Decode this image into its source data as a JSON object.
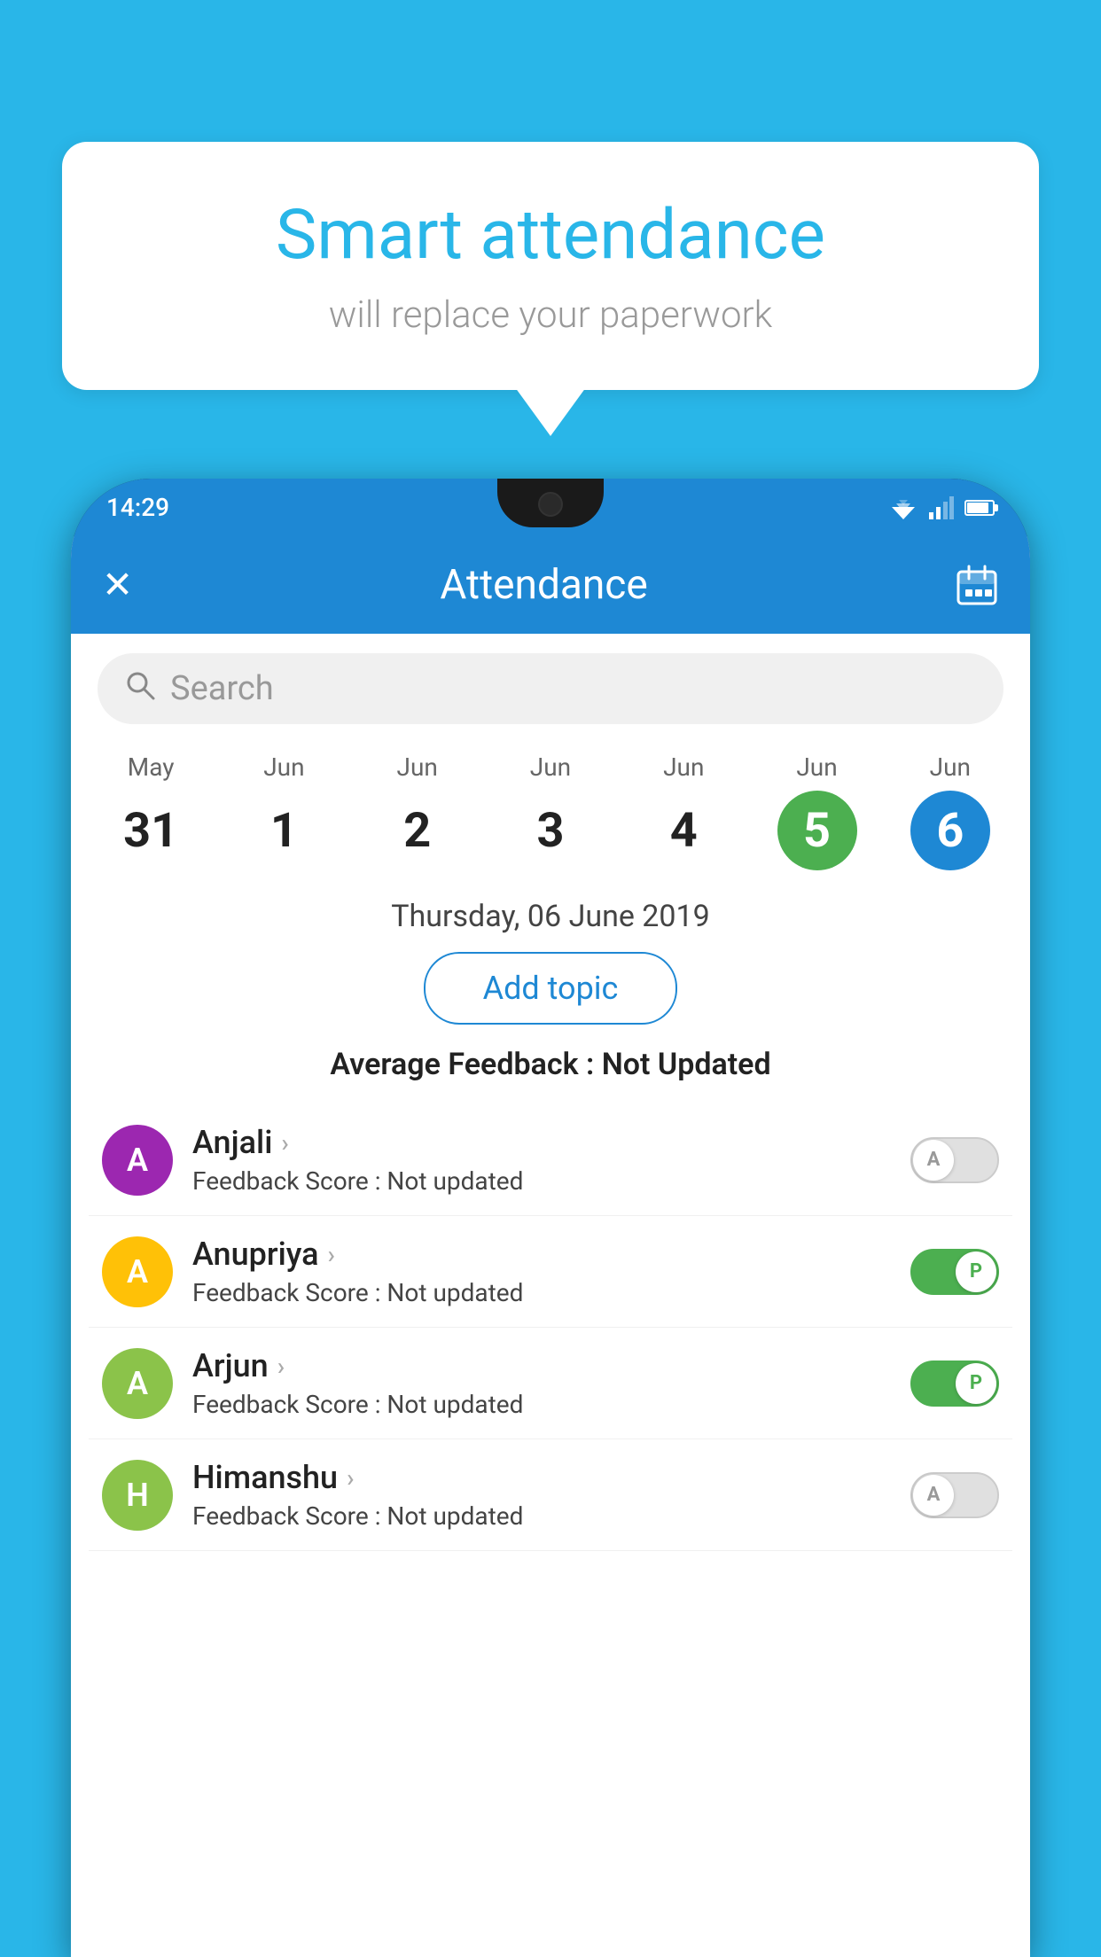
{
  "background_color": "#29b6e8",
  "bubble": {
    "title": "Smart attendance",
    "subtitle": "will replace your paperwork"
  },
  "status_bar": {
    "time": "14:29"
  },
  "app_bar": {
    "title": "Attendance",
    "close_label": "✕",
    "calendar_icon": "calendar"
  },
  "search": {
    "placeholder": "Search"
  },
  "calendar": {
    "days": [
      {
        "month": "May",
        "date": "31",
        "style": "normal"
      },
      {
        "month": "Jun",
        "date": "1",
        "style": "normal"
      },
      {
        "month": "Jun",
        "date": "2",
        "style": "normal"
      },
      {
        "month": "Jun",
        "date": "3",
        "style": "normal"
      },
      {
        "month": "Jun",
        "date": "4",
        "style": "normal"
      },
      {
        "month": "Jun",
        "date": "5",
        "style": "today"
      },
      {
        "month": "Jun",
        "date": "6",
        "style": "selected"
      }
    ]
  },
  "selected_date": "Thursday, 06 June 2019",
  "add_topic_label": "Add topic",
  "avg_feedback_label": "Average Feedback : ",
  "avg_feedback_value": "Not Updated",
  "students": [
    {
      "name": "Anjali",
      "avatar_letter": "A",
      "avatar_color": "#9c27b0",
      "feedback_label": "Feedback Score : ",
      "feedback_value": "Not updated",
      "toggle_state": "off",
      "toggle_label": "A"
    },
    {
      "name": "Anupriya",
      "avatar_letter": "A",
      "avatar_color": "#ffc107",
      "feedback_label": "Feedback Score : ",
      "feedback_value": "Not updated",
      "toggle_state": "on",
      "toggle_label": "P"
    },
    {
      "name": "Arjun",
      "avatar_letter": "A",
      "avatar_color": "#8bc34a",
      "feedback_label": "Feedback Score : ",
      "feedback_value": "Not updated",
      "toggle_state": "on",
      "toggle_label": "P"
    },
    {
      "name": "Himanshu",
      "avatar_letter": "H",
      "avatar_color": "#8bc34a",
      "feedback_label": "Feedback Score : ",
      "feedback_value": "Not updated",
      "toggle_state": "off",
      "toggle_label": "A"
    }
  ]
}
